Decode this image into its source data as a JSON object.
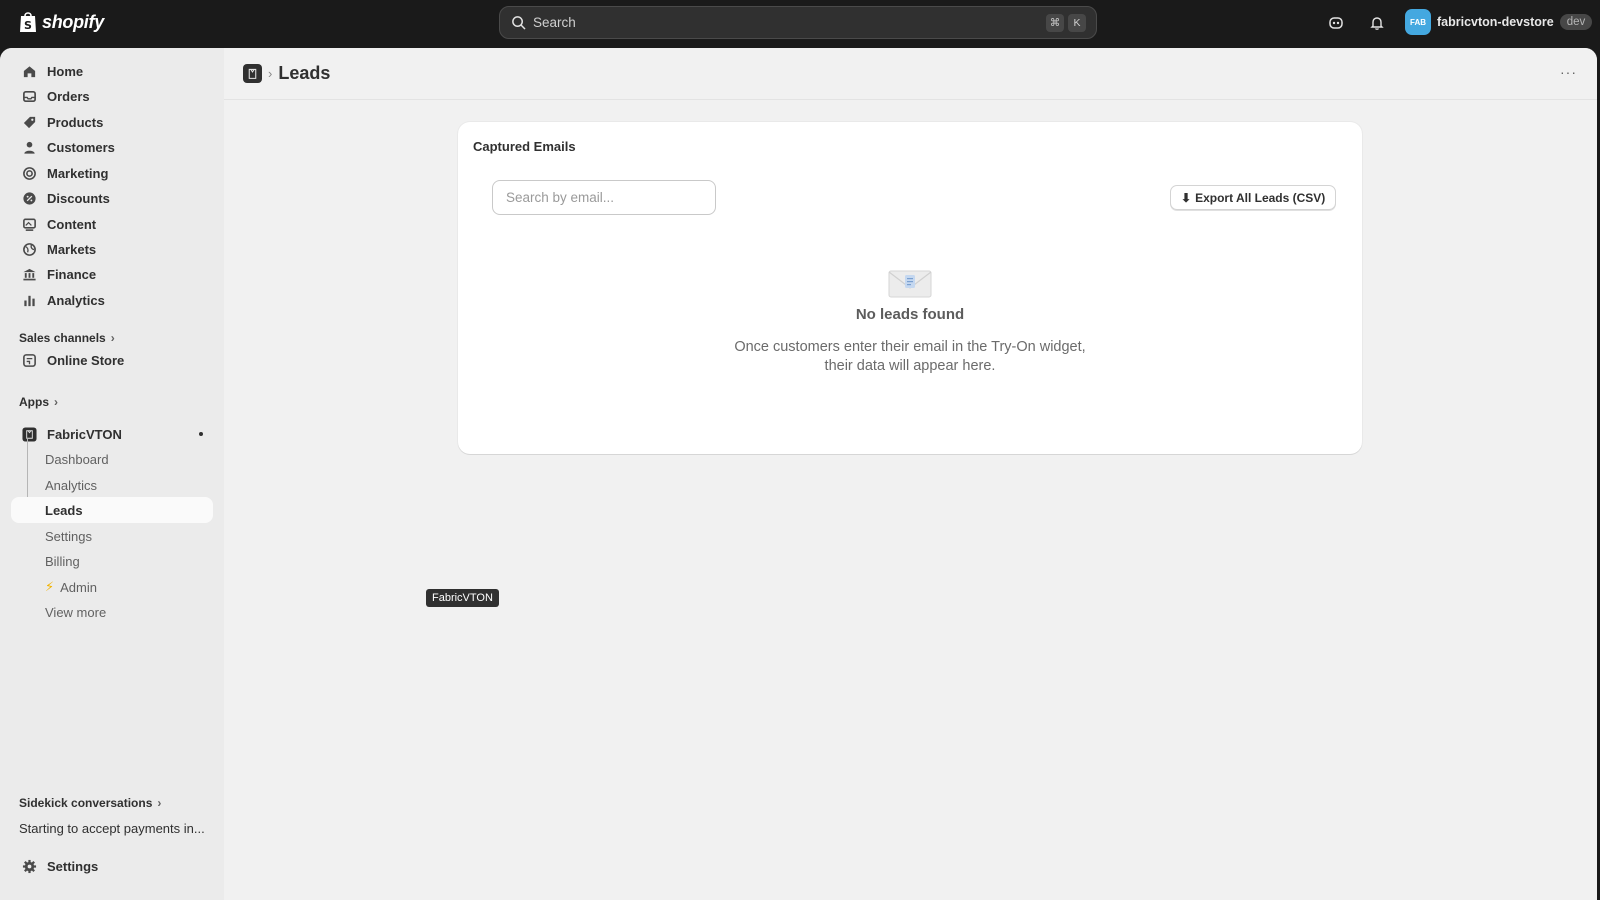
{
  "topbar": {
    "logo_text": "shopify",
    "search_placeholder": "Search",
    "shortcut_key1": "⌘",
    "shortcut_key2": "K",
    "avatar_initials": "FAB",
    "store_name": "fabricvton-devstore",
    "env_badge": "dev"
  },
  "sidebar": {
    "nav": [
      {
        "label": "Home",
        "icon": "home-icon"
      },
      {
        "label": "Orders",
        "icon": "orders-icon"
      },
      {
        "label": "Products",
        "icon": "tag-icon"
      },
      {
        "label": "Customers",
        "icon": "person-icon"
      },
      {
        "label": "Marketing",
        "icon": "target-icon"
      },
      {
        "label": "Discounts",
        "icon": "discount-icon"
      },
      {
        "label": "Content",
        "icon": "content-icon"
      },
      {
        "label": "Markets",
        "icon": "globe-icon"
      },
      {
        "label": "Finance",
        "icon": "bank-icon"
      },
      {
        "label": "Analytics",
        "icon": "bar-chart-icon"
      }
    ],
    "sales_channels_label": "Sales channels",
    "online_store_label": "Online Store",
    "apps_label": "Apps",
    "app_name": "FabricVTON",
    "app_subitems": [
      "Dashboard",
      "Analytics",
      "Leads",
      "Settings",
      "Billing",
      "Admin",
      "View more"
    ],
    "sidekick_label": "Sidekick conversations",
    "sidekick_item": "Starting to accept payments in...",
    "settings_label": "Settings"
  },
  "main": {
    "breadcrumb_sep": "›",
    "page_title": "Leads",
    "more_label": "···",
    "card": {
      "title": "Captured Emails",
      "search_placeholder": "Search by email...",
      "export_label": "Export All Leads (CSV)",
      "empty_title": "No leads found",
      "empty_desc_line1": "Once customers enter their email in the Try-On widget,",
      "empty_desc_line2": "their data will appear here."
    },
    "tooltip": "FabricVTON"
  }
}
